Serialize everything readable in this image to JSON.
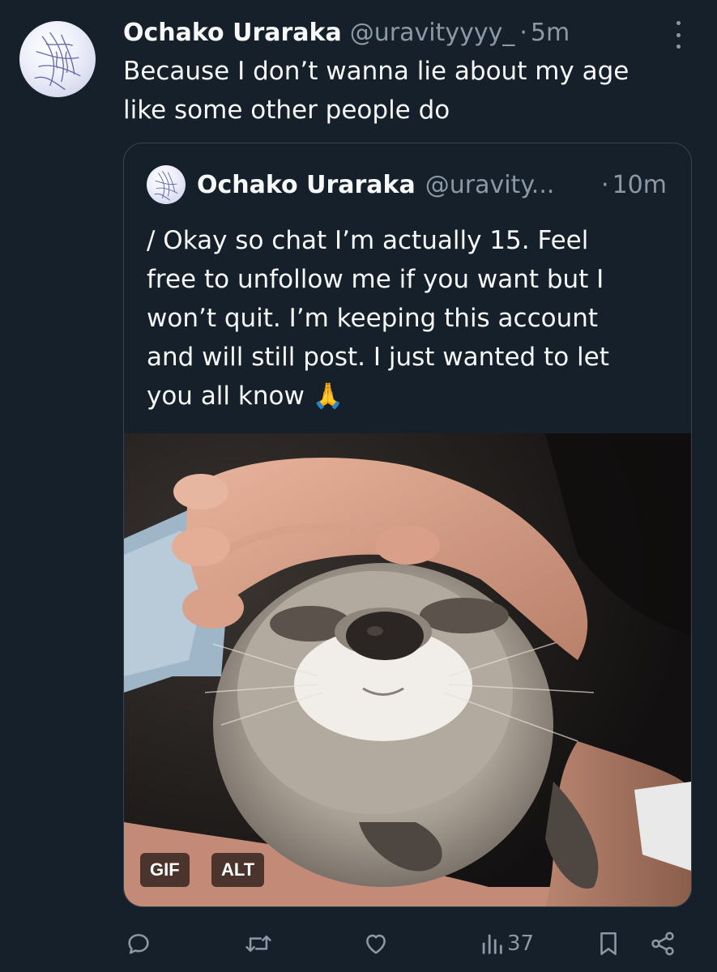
{
  "tweet": {
    "display_name": "Ochako Uraraka",
    "handle": "@uravityyyy_",
    "separator": "·",
    "time": "5m",
    "text_line1": "Because I don’t wanna lie about my age",
    "text_line2": "like some other people do"
  },
  "quote": {
    "display_name": "Ochako Uraraka",
    "handle": "@uravity...",
    "separator": "·",
    "time": "10m",
    "lines": [
      "/ Okay so chat I’m actually 15. Feel",
      "free to unfollow me if you want but I",
      "won’t quit. I’m keeping this account",
      "and will still post. I just wanted to let",
      "you all know 🙏"
    ],
    "media": {
      "gif_badge": "GIF",
      "alt_badge": "ALT"
    }
  },
  "actions": {
    "reply_icon": "reply-icon",
    "retweet_icon": "retweet-icon",
    "like_icon": "heart-icon",
    "views_icon": "views-icon",
    "views_count": "37",
    "bookmark_icon": "bookmark-icon",
    "share_icon": "share-icon"
  },
  "colors": {
    "background": "#15202b",
    "primary_text": "#f7f9f9",
    "secondary_text": "#8b98a5",
    "border": "#38444d"
  }
}
